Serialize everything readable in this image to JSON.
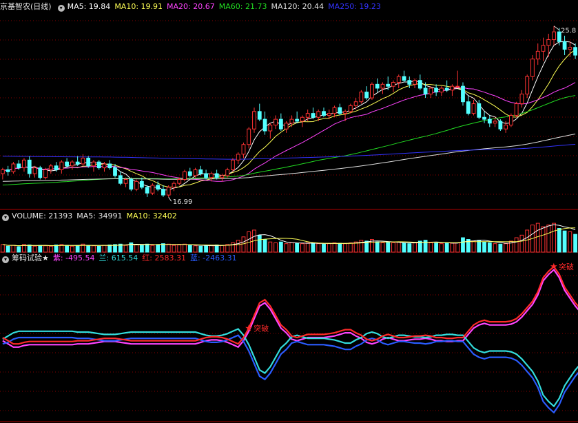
{
  "colors": {
    "background": "#000000",
    "up": "#ff3333",
    "down": "#54ffff",
    "grid": "#8b0000",
    "divider": "#b00000",
    "ma5": "#ffffff",
    "ma10": "#ffff55",
    "ma20": "#ff44ff",
    "ma60": "#22dd22",
    "ma120": "#e0e0e0",
    "ma250": "#3333ff",
    "zi": "#ff44ff",
    "lan": "#33dddd",
    "hong": "#ff2a2a",
    "lanblue": "#2a5cff"
  },
  "price_panel": {
    "title": "京基智农(日线)",
    "legend": [
      {
        "label": "MA5: 19.84",
        "color": "#ffffff"
      },
      {
        "label": "MA10: 19.91",
        "color": "#ffff55"
      },
      {
        "label": "MA20: 20.67",
        "color": "#ff44ff"
      },
      {
        "label": "MA60: 21.73",
        "color": "#22dd22"
      },
      {
        "label": "MA120: 20.44",
        "color": "#e0e0e0"
      },
      {
        "label": "MA250: 19.23",
        "color": "#3333ff"
      }
    ],
    "high_label": "25.8",
    "low_label": "16.99"
  },
  "volume_panel": {
    "legend": [
      {
        "label": "VOLUME: 21393",
        "color": "#e6e6e6"
      },
      {
        "label": "MA5: 34991",
        "color": "#e6e6e6"
      },
      {
        "label": "MA10: 32402",
        "color": "#ffff55"
      }
    ]
  },
  "indicator_panel": {
    "title": "筹码试验★",
    "legend": [
      {
        "label": "紫: -495.54",
        "color": "#ff44ff"
      },
      {
        "label": "兰: 615.54",
        "color": "#33dddd"
      },
      {
        "label": "红: 2583.31",
        "color": "#ff2a2a"
      },
      {
        "label": "蓝: -2463.31",
        "color": "#2a5cff"
      }
    ],
    "signals": [
      {
        "label": "突破",
        "index": 46
      },
      {
        "label": "突破",
        "index": 103
      }
    ]
  },
  "chart_data": {
    "type": "candlestick",
    "price_range": [
      16.5,
      26.5
    ],
    "candles": [
      [
        18.2,
        18.5,
        17.9,
        18.4
      ],
      [
        18.4,
        18.6,
        18.1,
        18.3
      ],
      [
        18.3,
        18.8,
        18.2,
        18.7
      ],
      [
        18.7,
        18.9,
        18.4,
        18.5
      ],
      [
        18.5,
        19.0,
        18.3,
        18.9
      ],
      [
        18.9,
        19.1,
        18.0,
        18.2
      ],
      [
        18.2,
        18.6,
        18.0,
        18.5
      ],
      [
        18.5,
        18.6,
        17.9,
        18.0
      ],
      [
        18.0,
        18.5,
        17.9,
        18.4
      ],
      [
        18.4,
        18.7,
        18.2,
        18.6
      ],
      [
        18.6,
        18.8,
        18.3,
        18.4
      ],
      [
        18.4,
        18.9,
        18.2,
        18.8
      ],
      [
        18.8,
        19.0,
        18.5,
        18.6
      ],
      [
        18.6,
        18.9,
        18.4,
        18.8
      ],
      [
        18.8,
        19.1,
        18.6,
        18.7
      ],
      [
        18.7,
        19.2,
        18.6,
        19.0
      ],
      [
        19.0,
        19.1,
        18.5,
        18.6
      ],
      [
        18.6,
        18.9,
        18.3,
        18.8
      ],
      [
        18.8,
        18.9,
        18.4,
        18.5
      ],
      [
        18.5,
        18.8,
        18.3,
        18.7
      ],
      [
        18.7,
        18.9,
        18.4,
        18.5
      ],
      [
        18.5,
        18.7,
        18.0,
        18.1
      ],
      [
        18.1,
        18.3,
        17.6,
        17.7
      ],
      [
        17.7,
        18.0,
        17.5,
        17.9
      ],
      [
        17.9,
        18.0,
        17.3,
        17.4
      ],
      [
        17.4,
        17.9,
        17.3,
        17.8
      ],
      [
        17.8,
        18.0,
        17.4,
        17.5
      ],
      [
        17.5,
        17.6,
        17.0,
        17.2
      ],
      [
        17.2,
        17.7,
        17.1,
        17.6
      ],
      [
        17.6,
        17.8,
        17.3,
        17.4
      ],
      [
        17.4,
        17.6,
        17.0,
        17.1
      ],
      [
        17.1,
        17.6,
        16.99,
        17.5
      ],
      [
        17.5,
        17.8,
        17.3,
        17.7
      ],
      [
        17.7,
        18.0,
        17.6,
        17.9
      ],
      [
        17.9,
        18.4,
        17.8,
        18.3
      ],
      [
        18.3,
        18.5,
        18.0,
        18.1
      ],
      [
        18.1,
        18.5,
        18.0,
        18.4
      ],
      [
        18.4,
        18.6,
        18.1,
        18.2
      ],
      [
        18.2,
        18.4,
        17.9,
        18.0
      ],
      [
        18.0,
        18.3,
        17.8,
        18.2
      ],
      [
        18.2,
        18.4,
        17.9,
        18.0
      ],
      [
        18.0,
        18.2,
        17.8,
        18.1
      ],
      [
        18.1,
        18.5,
        18.0,
        18.4
      ],
      [
        18.4,
        19.0,
        18.3,
        18.9
      ],
      [
        18.9,
        19.3,
        18.7,
        19.2
      ],
      [
        19.2,
        19.8,
        19.0,
        19.7
      ],
      [
        19.7,
        20.6,
        19.5,
        20.5
      ],
      [
        20.5,
        21.6,
        20.3,
        21.4
      ],
      [
        21.4,
        21.8,
        20.9,
        21.0
      ],
      [
        21.0,
        21.4,
        20.2,
        20.4
      ],
      [
        20.4,
        20.8,
        20.0,
        20.7
      ],
      [
        20.7,
        21.2,
        20.5,
        21.0
      ],
      [
        21.0,
        21.3,
        20.4,
        20.5
      ],
      [
        20.5,
        20.9,
        20.3,
        20.8
      ],
      [
        20.8,
        21.2,
        20.6,
        21.0
      ],
      [
        21.0,
        21.4,
        20.8,
        20.9
      ],
      [
        20.9,
        21.2,
        20.6,
        21.1
      ],
      [
        21.1,
        21.5,
        20.9,
        21.3
      ],
      [
        21.3,
        21.6,
        21.0,
        21.1
      ],
      [
        21.1,
        21.5,
        20.9,
        21.4
      ],
      [
        21.4,
        21.6,
        21.1,
        21.2
      ],
      [
        21.2,
        21.5,
        21.0,
        21.3
      ],
      [
        21.3,
        21.7,
        21.1,
        21.6
      ],
      [
        21.6,
        21.8,
        21.2,
        21.3
      ],
      [
        21.3,
        21.5,
        20.9,
        21.4
      ],
      [
        21.4,
        21.8,
        21.3,
        21.7
      ],
      [
        21.7,
        22.1,
        21.5,
        21.9
      ],
      [
        21.9,
        22.5,
        21.8,
        22.4
      ],
      [
        22.4,
        22.7,
        22.0,
        22.1
      ],
      [
        22.1,
        22.9,
        22.0,
        22.8
      ],
      [
        22.8,
        23.1,
        22.4,
        22.6
      ],
      [
        22.6,
        22.9,
        22.3,
        22.8
      ],
      [
        22.8,
        23.2,
        22.5,
        22.7
      ],
      [
        22.7,
        23.0,
        22.4,
        22.9
      ],
      [
        22.9,
        23.3,
        22.6,
        23.2
      ],
      [
        23.2,
        23.5,
        22.9,
        23.0
      ],
      [
        23.0,
        23.2,
        22.6,
        22.8
      ],
      [
        22.8,
        23.1,
        22.6,
        23.0
      ],
      [
        23.0,
        23.3,
        22.5,
        22.6
      ],
      [
        22.6,
        22.9,
        22.1,
        22.3
      ],
      [
        22.3,
        22.7,
        22.1,
        22.6
      ],
      [
        22.6,
        22.8,
        22.2,
        22.4
      ],
      [
        22.4,
        22.7,
        22.2,
        22.6
      ],
      [
        22.6,
        23.0,
        22.4,
        22.5
      ],
      [
        22.5,
        22.8,
        22.2,
        22.7
      ],
      [
        22.7,
        23.5,
        22.6,
        22.7
      ],
      [
        22.7,
        22.9,
        21.7,
        21.9
      ],
      [
        21.9,
        22.2,
        21.2,
        21.3
      ],
      [
        21.3,
        22.0,
        21.2,
        21.8
      ],
      [
        21.8,
        22.0,
        21.0,
        21.1
      ],
      [
        21.1,
        21.4,
        20.8,
        21.0
      ],
      [
        21.0,
        21.2,
        20.6,
        20.8
      ],
      [
        20.8,
        21.1,
        20.6,
        20.9
      ],
      [
        20.9,
        21.0,
        20.4,
        20.5
      ],
      [
        20.5,
        20.9,
        20.3,
        20.7
      ],
      [
        20.7,
        21.3,
        20.6,
        21.2
      ],
      [
        21.2,
        21.9,
        21.1,
        21.8
      ],
      [
        21.8,
        22.5,
        21.6,
        22.3
      ],
      [
        22.3,
        23.3,
        22.1,
        23.2
      ],
      [
        23.2,
        24.3,
        23.0,
        24.1
      ],
      [
        24.1,
        24.9,
        23.8,
        24.5
      ],
      [
        24.5,
        25.2,
        24.0,
        24.8
      ],
      [
        24.8,
        25.4,
        24.2,
        25.1
      ],
      [
        25.1,
        25.8,
        24.8,
        25.5
      ],
      [
        25.5,
        25.7,
        24.8,
        25.0
      ],
      [
        25.0,
        25.3,
        24.3,
        24.6
      ],
      [
        24.6,
        25.0,
        24.2,
        24.7
      ],
      [
        24.7,
        24.9,
        24.1,
        24.3
      ]
    ],
    "volume": [
      90,
      70,
      80,
      65,
      90,
      85,
      70,
      80,
      75,
      70,
      85,
      90,
      80,
      70,
      75,
      95,
      80,
      75,
      70,
      80,
      85,
      90,
      95,
      80,
      110,
      90,
      85,
      95,
      80,
      90,
      100,
      95,
      80,
      85,
      95,
      80,
      75,
      70,
      75,
      80,
      85,
      80,
      90,
      110,
      140,
      180,
      240,
      260,
      200,
      150,
      120,
      110,
      120,
      100,
      110,
      105,
      100,
      110,
      105,
      100,
      95,
      100,
      110,
      105,
      100,
      110,
      120,
      140,
      130,
      150,
      120,
      110,
      115,
      110,
      120,
      105,
      100,
      110,
      130,
      140,
      110,
      105,
      100,
      110,
      105,
      110,
      170,
      150,
      130,
      140,
      120,
      110,
      100,
      95,
      100,
      130,
      170,
      200,
      260,
      320,
      340,
      300,
      320,
      340,
      280,
      250,
      240,
      210
    ],
    "indicators": {
      "zi": [
        -20,
        -40,
        -60,
        -60,
        -50,
        -45,
        -45,
        -45,
        -45,
        -45,
        -45,
        -45,
        -45,
        -45,
        -40,
        -40,
        -40,
        -35,
        -30,
        -25,
        -25,
        -25,
        -30,
        -35,
        -40,
        -40,
        -40,
        -40,
        -40,
        -40,
        -40,
        -40,
        -40,
        -40,
        -40,
        -40,
        -40,
        -30,
        -20,
        -15,
        -15,
        -20,
        -30,
        -45,
        -60,
        -20,
        40,
        120,
        200,
        220,
        180,
        120,
        60,
        30,
        -10,
        -20,
        -10,
        0,
        0,
        0,
        0,
        5,
        10,
        20,
        30,
        30,
        10,
        -5,
        -30,
        -40,
        -30,
        -10,
        0,
        -10,
        -20,
        -20,
        -15,
        -10,
        -10,
        -5,
        -10,
        -20,
        -20,
        -25,
        -25,
        -20,
        -20,
        20,
        60,
        80,
        90,
        80,
        80,
        80,
        80,
        85,
        100,
        130,
        170,
        210,
        270,
        360,
        400,
        430,
        380,
        300,
        250,
        200,
        160,
        150,
        130
      ],
      "lan": [
        -10,
        10,
        30,
        40,
        40,
        40,
        40,
        40,
        40,
        40,
        40,
        40,
        40,
        40,
        35,
        35,
        35,
        30,
        25,
        20,
        20,
        20,
        25,
        30,
        35,
        35,
        35,
        35,
        35,
        35,
        35,
        35,
        35,
        35,
        35,
        35,
        35,
        25,
        15,
        10,
        10,
        15,
        25,
        40,
        55,
        15,
        -45,
        -125,
        -205,
        -225,
        -185,
        -125,
        -65,
        -35,
        5,
        15,
        5,
        -5,
        -5,
        -5,
        -5,
        -10,
        -15,
        -25,
        -35,
        -35,
        -15,
        0,
        25,
        35,
        25,
        5,
        -5,
        5,
        15,
        15,
        10,
        5,
        5,
        0,
        5,
        15,
        15,
        20,
        20,
        15,
        15,
        -25,
        -65,
        -85,
        -95,
        -85,
        -85,
        -85,
        -85,
        -90,
        -105,
        -135,
        -175,
        -215,
        -275,
        -365,
        -405,
        -435,
        -385,
        -305,
        -255,
        -205,
        -165,
        -155,
        -135
      ],
      "hong": [
        0,
        -20,
        -40,
        -40,
        -30,
        -25,
        -25,
        -25,
        -25,
        -25,
        -25,
        -25,
        -25,
        -25,
        -20,
        -20,
        -20,
        -15,
        -10,
        -5,
        -5,
        -5,
        -10,
        -15,
        -20,
        -20,
        -20,
        -20,
        -20,
        -20,
        -20,
        -20,
        -20,
        -20,
        -20,
        -20,
        -20,
        -10,
        0,
        5,
        5,
        0,
        -10,
        -25,
        -40,
        0,
        60,
        140,
        220,
        240,
        200,
        140,
        80,
        50,
        10,
        0,
        10,
        20,
        20,
        20,
        20,
        25,
        30,
        40,
        50,
        50,
        30,
        15,
        -10,
        -20,
        -10,
        10,
        20,
        10,
        0,
        0,
        5,
        10,
        10,
        15,
        10,
        0,
        0,
        -5,
        -5,
        0,
        0,
        40,
        80,
        100,
        110,
        100,
        100,
        100,
        100,
        105,
        120,
        150,
        190,
        230,
        290,
        380,
        420,
        450,
        400,
        320,
        270,
        220,
        180,
        170,
        150
      ],
      "lanblue": [
        -40,
        -30,
        -10,
        0,
        0,
        0,
        0,
        0,
        0,
        0,
        0,
        0,
        0,
        0,
        -5,
        -5,
        -5,
        -10,
        -15,
        -20,
        -20,
        -20,
        -15,
        -10,
        -5,
        -5,
        -5,
        -5,
        -5,
        -5,
        -5,
        -5,
        -5,
        -5,
        -5,
        -5,
        -5,
        -15,
        -25,
        -30,
        -30,
        -25,
        -15,
        0,
        15,
        -25,
        -85,
        -165,
        -245,
        -265,
        -225,
        -165,
        -105,
        -75,
        -35,
        -25,
        -35,
        -45,
        -45,
        -45,
        -45,
        -50,
        -55,
        -65,
        -75,
        -75,
        -55,
        -40,
        -15,
        -5,
        -15,
        -35,
        -45,
        -35,
        -25,
        -25,
        -30,
        -35,
        -35,
        -40,
        -35,
        -25,
        -25,
        -20,
        -20,
        -25,
        -25,
        -65,
        -105,
        -125,
        -135,
        -125,
        -125,
        -125,
        -125,
        -130,
        -145,
        -175,
        -215,
        -255,
        -315,
        -405,
        -445,
        -475,
        -425,
        -345,
        -295,
        -245,
        -205,
        -195,
        -175
      ]
    }
  }
}
